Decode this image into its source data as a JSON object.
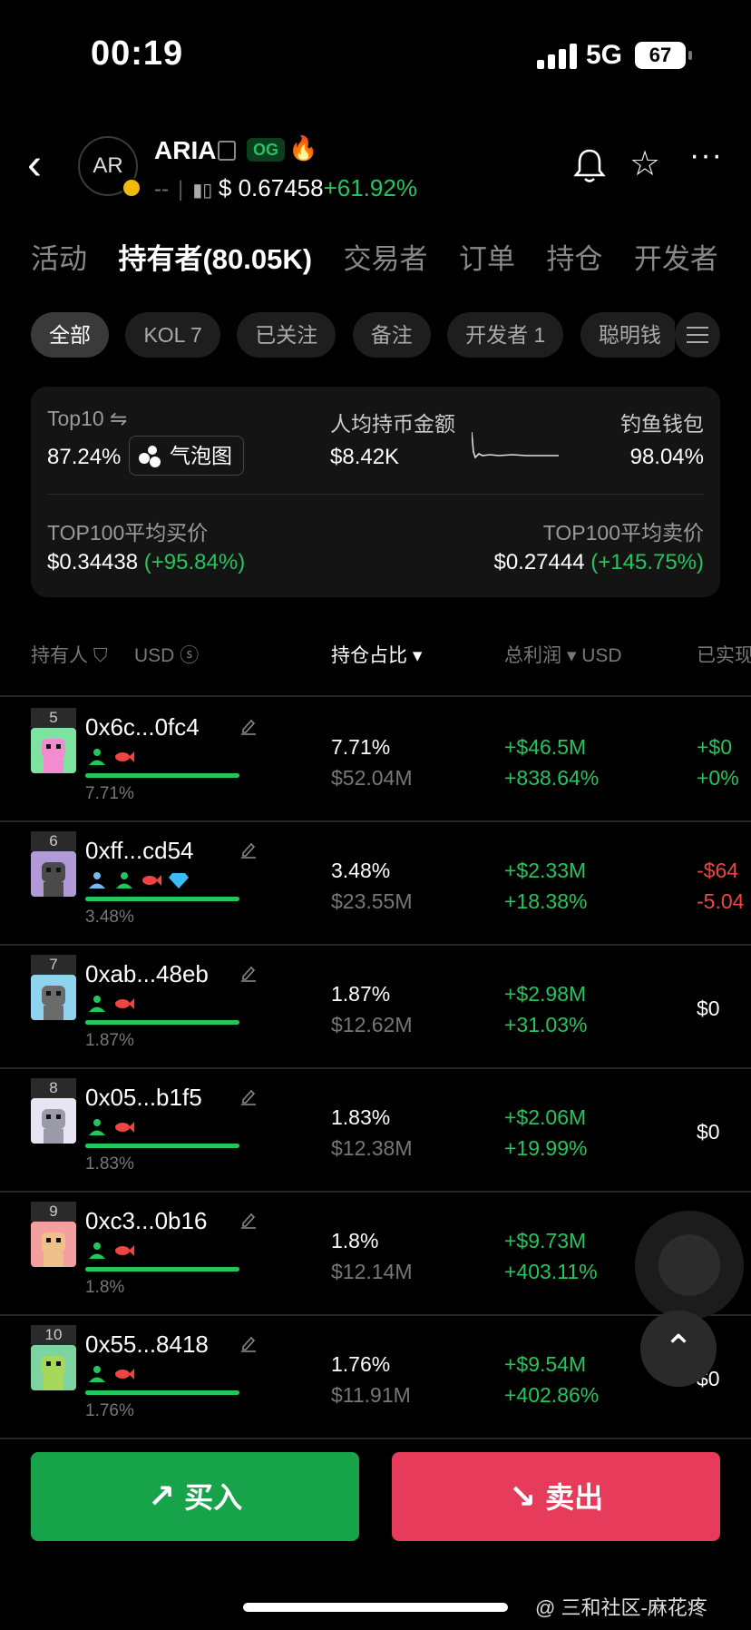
{
  "status_bar": {
    "time": "00:19",
    "network": "5G",
    "battery": "67"
  },
  "header": {
    "avatar_text": "AR",
    "token_name": "ARIA",
    "og_badge": "OG",
    "dash": "--",
    "price": "$ 0.67458",
    "change": "+61.92%"
  },
  "tabs": [
    {
      "label": "活动"
    },
    {
      "label": "持有者(80.05K)"
    },
    {
      "label": "交易者"
    },
    {
      "label": "订单"
    },
    {
      "label": "持仓"
    },
    {
      "label": "开发者"
    }
  ],
  "chips": [
    {
      "label": "全部"
    },
    {
      "label": "KOL 7"
    },
    {
      "label": "已关注"
    },
    {
      "label": "备注"
    },
    {
      "label": "开发者 1"
    },
    {
      "label": "聪明钱"
    }
  ],
  "summary": {
    "top10_label": "Top10 ⇋",
    "top10_value": "87.24%",
    "bubble_label": "气泡图",
    "avg_hold_label": "人均持币金额",
    "avg_hold_value": "$8.42K",
    "phishing_label": "钓鱼钱包",
    "phishing_value": "98.04%",
    "top100_buy_label": "TOP100平均买价",
    "top100_buy_value": "$0.34438",
    "top100_buy_change": "(+95.84%)",
    "top100_sell_label": "TOP100平均卖价",
    "top100_sell_value": "$0.27444",
    "top100_sell_change": "(+145.75%)"
  },
  "table_header": {
    "holder": "持有人",
    "usd_toggle": "USD",
    "holding_pct": "持仓占比",
    "total_pnl": "总利润",
    "pnl_unit": "USD",
    "realized": "已实现"
  },
  "rows": [
    {
      "rank": "5",
      "address": "0x6c...0fc4",
      "sub_pct": "7.71%",
      "bar_fraction": 1.0,
      "pct": "7.71%",
      "usd": "$52.04M",
      "pnl": "+$46.5M",
      "pnl_pct": "+838.64%",
      "realized": "+$0",
      "realized_pct": "+0%",
      "tags": [
        "person-icon",
        "fish-icon"
      ],
      "colors": {
        "bg": "#7ee3a0",
        "face": "#f38bd0"
      }
    },
    {
      "rank": "6",
      "address": "0xff...cd54",
      "sub_pct": "3.48%",
      "bar_fraction": 1.0,
      "pct": "3.48%",
      "usd": "$23.55M",
      "pnl": "+$2.33M",
      "pnl_pct": "+18.38%",
      "realized": "-$64",
      "realized_pct": "-5.04",
      "tags": [
        "person-outline-icon",
        "person-icon",
        "fish-icon",
        "diamond-icon"
      ],
      "colors": {
        "bg": "#b29ad8",
        "face": "#4a4a4a"
      }
    },
    {
      "rank": "7",
      "address": "0xab...48eb",
      "sub_pct": "1.87%",
      "bar_fraction": 1.0,
      "pct": "1.87%",
      "usd": "$12.62M",
      "pnl": "+$2.98M",
      "pnl_pct": "+31.03%",
      "realized": "$0",
      "realized_pct": "",
      "tags": [
        "person-icon",
        "fish-icon"
      ],
      "colors": {
        "bg": "#8fd3f0",
        "face": "#6b6b6b"
      }
    },
    {
      "rank": "8",
      "address": "0x05...b1f5",
      "sub_pct": "1.83%",
      "bar_fraction": 1.0,
      "pct": "1.83%",
      "usd": "$12.38M",
      "pnl": "+$2.06M",
      "pnl_pct": "+19.99%",
      "realized": "$0",
      "realized_pct": "",
      "tags": [
        "person-icon",
        "fish-icon"
      ],
      "colors": {
        "bg": "#e8e4f4",
        "face": "#9a9aa8"
      }
    },
    {
      "rank": "9",
      "address": "0xc3...0b16",
      "sub_pct": "1.8%",
      "bar_fraction": 1.0,
      "pct": "1.8%",
      "usd": "$12.14M",
      "pnl": "+$9.73M",
      "pnl_pct": "+403.11%",
      "realized": "$0",
      "realized_pct": "",
      "tags": [
        "person-icon",
        "fish-icon"
      ],
      "colors": {
        "bg": "#f4a0a0",
        "face": "#f0c08a"
      }
    },
    {
      "rank": "10",
      "address": "0x55...8418",
      "sub_pct": "1.76%",
      "bar_fraction": 1.0,
      "pct": "1.76%",
      "usd": "$11.91M",
      "pnl": "+$9.54M",
      "pnl_pct": "+402.86%",
      "realized": "$0",
      "realized_pct": "",
      "tags": [
        "person-icon",
        "fish-icon"
      ],
      "colors": {
        "bg": "#7ed4a0",
        "face": "#a8d85a"
      }
    }
  ],
  "actions": {
    "buy": "买入",
    "sell": "卖出"
  },
  "watermark": "@ 三和社区-麻花疼",
  "colors": {
    "green": "#22c55e",
    "red": "#ef4444",
    "buy_bg": "#16a34a",
    "sell_bg": "#e63b5a"
  }
}
